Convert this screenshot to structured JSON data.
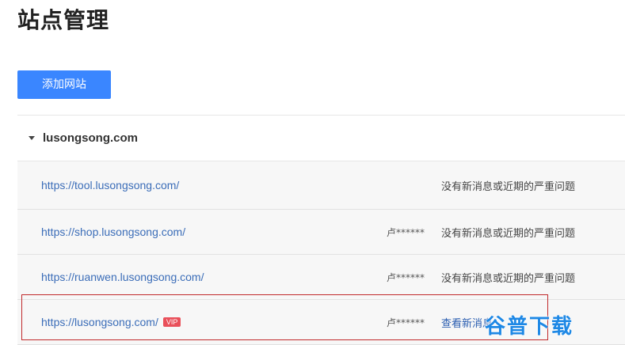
{
  "page": {
    "title": "站点管理"
  },
  "toolbar": {
    "add_site_label": "添加网站"
  },
  "group": {
    "name": "lusongsong.com",
    "expanded": true
  },
  "sites": [
    {
      "url": "https://tool.lusongsong.com/",
      "owner": "",
      "status": "没有新消息或近期的严重问题",
      "vip": false
    },
    {
      "url": "https://shop.lusongsong.com/",
      "owner": "卢******",
      "status": "没有新消息或近期的严重问题",
      "vip": false
    },
    {
      "url": "https://ruanwen.lusongsong.com/",
      "owner": "卢******",
      "status": "没有新消息或近期的严重问题",
      "vip": false
    },
    {
      "url": "https://lusongsong.com/",
      "owner": "卢******",
      "status": "查看新消息",
      "vip": true,
      "vip_label": "VIP"
    }
  ],
  "watermark": {
    "text": "谷普下载"
  },
  "colors": {
    "accent": "#3a86ff",
    "link": "#3b6db8",
    "vip_badge": "#e9505a",
    "highlight": "#c0282a",
    "watermark": "#1e88e5"
  }
}
